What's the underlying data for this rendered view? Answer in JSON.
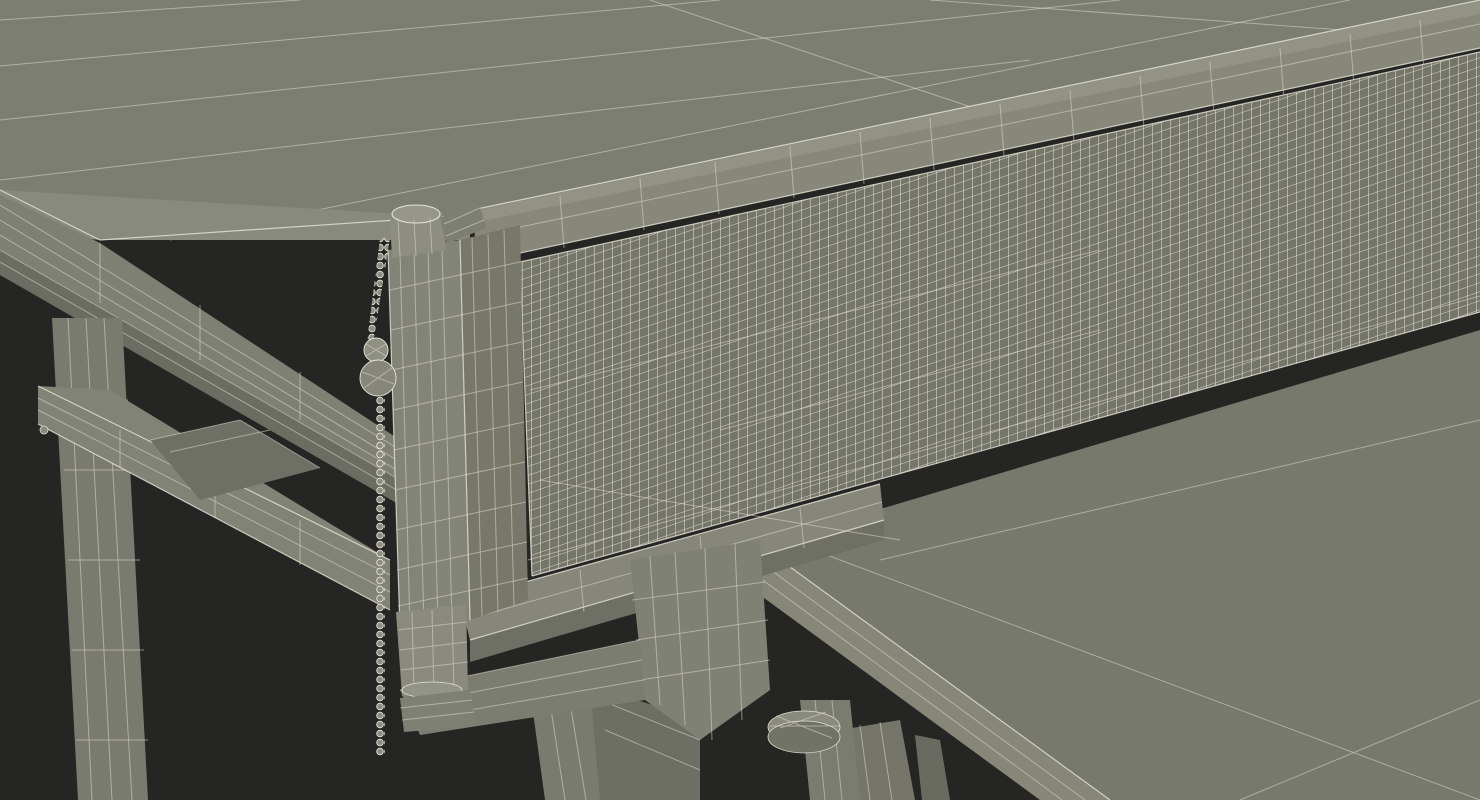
{
  "scene": {
    "subject": "ping-pong-table-net-post-wireframe",
    "colors": {
      "background": "#252624",
      "surface": "#7b7c70",
      "surface_dark": "#6a6b60",
      "surface_light": "#8a8b7f",
      "wireframe": "#d9dacb",
      "net_mesh": "#e9eadc"
    }
  }
}
